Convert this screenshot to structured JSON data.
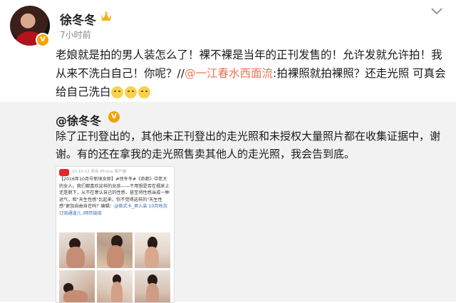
{
  "post": {
    "username": "徐冬冬",
    "time": "7小时前",
    "text_before": "老娘就是拍的男人装怎么了！裸不裸是当年的正刊发售的！允许发就允许拍！我从来不洗白自己！你呢？//",
    "mention": "@一江春水西面流",
    "text_after": ":拍裸照就拍裸照？还走光照 可真会给自己洗白",
    "badge": "V",
    "icons": [
      "avatar",
      "crown-icon",
      "chevron-down-icon",
      "emoji-icon"
    ]
  },
  "quote": {
    "username": "@徐冬冬",
    "badge": "V",
    "text": "除了正刊登出的，其他未正刊登出的走光照和未授权大量照片都在收集证据中，谢谢。有的还在拿我的走光照售卖其他人的走光照，我会告到底。"
  },
  "embed": {
    "meta": "1h 10-12 来自 iPhone 客户端",
    "text_before": "【2016年10月号新境女郎】#徐冬冬#《奇葩》中老大的女人。我们都喜欢这样的女孩——不用想是否在摆床上还是脱下，从不在意认自己的性感，甚至将性感当成一种运气，和\"天生性感\"比起来，你不觉得这样的\"天生性感\"更加自由自在吗？编辑：",
    "link_text": "@微式卡_男人装 10月收志订阅通道儿 /网页链接"
  },
  "colors": {
    "accent_link": "#eb7350",
    "badge": "#f5a200",
    "quote_bg": "#f2f2f2"
  }
}
